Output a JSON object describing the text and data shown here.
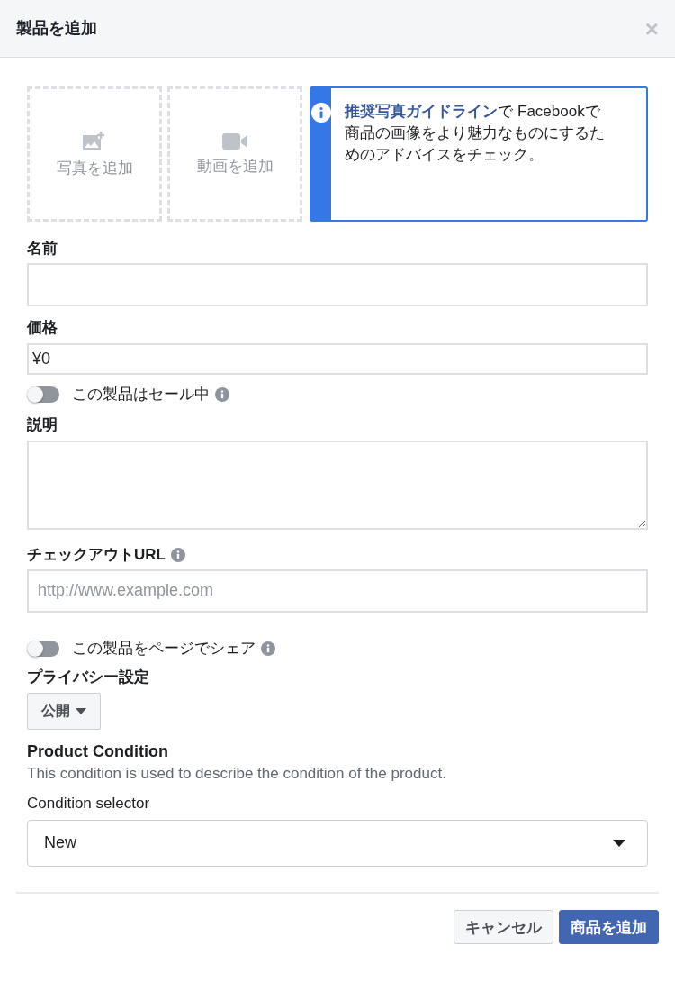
{
  "window": {
    "title": "製品を追加",
    "close": "×"
  },
  "media_tiles": [
    {
      "kind": "photo",
      "label": "写真を追加"
    },
    {
      "kind": "video",
      "label": "動画を追加"
    }
  ],
  "guideline": {
    "link": "推奨写真ガイドライン",
    "text": "で Facebookで商品の画像をより魅力なものにするためのアドバイスをチェック。"
  },
  "name_field": {
    "label": "名前"
  },
  "price_field": {
    "label": "価格",
    "value": "¥0"
  },
  "sale_toggle": {
    "label": "この製品はセール中",
    "on": false
  },
  "description_field": {
    "label": "説明"
  },
  "checkout_url_field": {
    "label": "チェックアウトURL",
    "placeholder": "http://www.example.com"
  },
  "share_toggle": {
    "label": "この製品をページでシェア",
    "on": false
  },
  "privacy": {
    "label": "プライバシー設定",
    "value": "公開"
  },
  "product_condition": {
    "title": "Product Condition",
    "description": "This condition is used to describe the condition of the product.",
    "selector_label": "Condition selector",
    "value": "New"
  },
  "buttons": [
    {
      "kind": "secondary",
      "label": "キャンセル"
    },
    {
      "kind": "primary",
      "label": "商品を追加"
    }
  ]
}
